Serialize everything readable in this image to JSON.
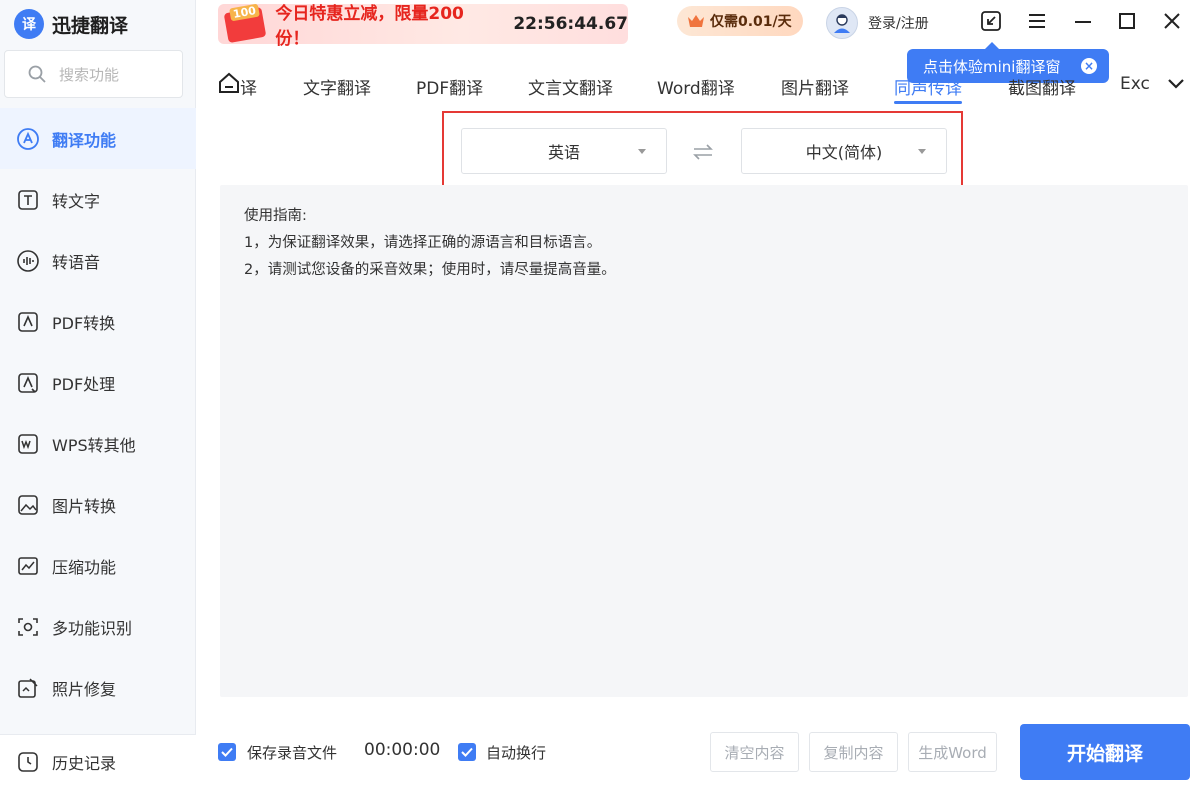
{
  "app": {
    "title": "迅捷翻译",
    "logo_glyph": "译"
  },
  "search": {
    "placeholder": "搜索功能"
  },
  "sidebar": {
    "items": [
      {
        "label": "翻译功能",
        "icon": "translate-icon",
        "active": true
      },
      {
        "label": "转文字",
        "icon": "text-convert-icon"
      },
      {
        "label": "转语音",
        "icon": "voice-icon"
      },
      {
        "label": "PDF转换",
        "icon": "pdf-convert-icon"
      },
      {
        "label": "PDF处理",
        "icon": "pdf-process-icon"
      },
      {
        "label": "WPS转其他",
        "icon": "wps-icon"
      },
      {
        "label": "图片转换",
        "icon": "image-convert-icon"
      },
      {
        "label": "压缩功能",
        "icon": "compress-icon"
      },
      {
        "label": "多功能识别",
        "icon": "recognize-icon"
      },
      {
        "label": "照片修复",
        "icon": "photo-repair-icon"
      }
    ],
    "history_label": "历史记录"
  },
  "header": {
    "promo_badge": "100",
    "promo_title": "今日特惠立减，限量200份！",
    "promo_timer": "22:56:44.67",
    "price_label": "仅需0.01/天",
    "login_label": "登录/注册",
    "tooltip": "点击体验mini翻译窗",
    "tooltip_close": "×"
  },
  "tabs": [
    {
      "label": "译"
    },
    {
      "label": "文字翻译"
    },
    {
      "label": "PDF翻译"
    },
    {
      "label": "文言文翻译"
    },
    {
      "label": "Word翻译"
    },
    {
      "label": "图片翻译"
    },
    {
      "label": "同声传译",
      "active": true
    },
    {
      "label": "截图翻译"
    },
    {
      "label": "Exc"
    }
  ],
  "language": {
    "source": "英语",
    "target": "中文(简体)"
  },
  "guide": {
    "title": "使用指南:",
    "line1": "1，为保证翻译效果，请选择正确的源语言和目标语言。",
    "line2": "2，请测试您设备的采音效果；使用时，请尽量提高音量。"
  },
  "bottom": {
    "save_audio_label": "保存录音文件",
    "timer": "00:00:00",
    "auto_wrap_label": "自动换行",
    "clear_label": "清空内容",
    "copy_label": "复制内容",
    "word_label": "生成Word",
    "start_label": "开始翻译"
  },
  "colors": {
    "accent": "#3f7cf4",
    "highlight": "#e53935",
    "promo_red": "#e6251e"
  }
}
